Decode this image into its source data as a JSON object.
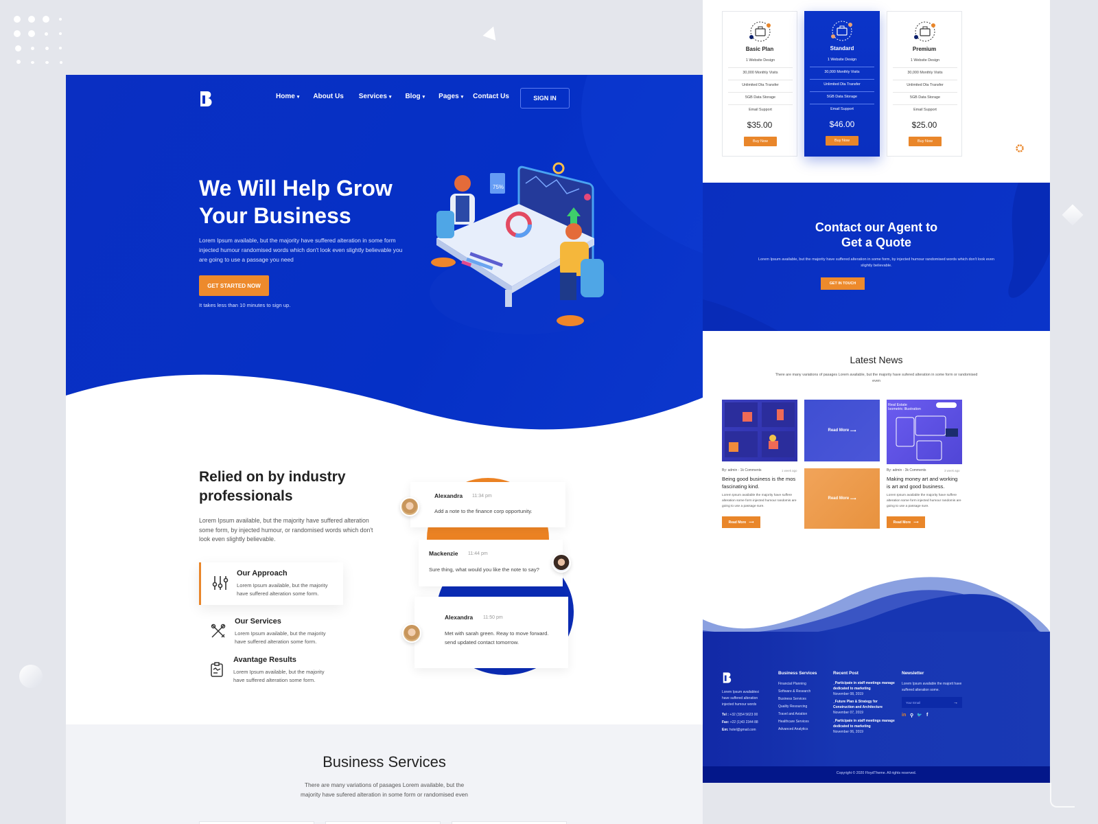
{
  "colors": {
    "primary": "#0a2fc2",
    "accent": "#ed8a2c",
    "dark_text": "#222222",
    "footer_bar": "#03178a"
  },
  "nav": {
    "logo": "b-logo",
    "items": [
      {
        "label": "Home",
        "has_dropdown": true
      },
      {
        "label": "About Us",
        "has_dropdown": false
      },
      {
        "label": "Services",
        "has_dropdown": true
      },
      {
        "label": "Blog",
        "has_dropdown": true
      },
      {
        "label": "Pages",
        "has_dropdown": true
      },
      {
        "label": "Contact Us",
        "has_dropdown": false
      }
    ],
    "caret": "▾",
    "signin_label": "SIGN IN"
  },
  "hero": {
    "title_line1": "We Will Help Grow",
    "title_line2": "Your Business",
    "description": "Lorem Ipsum available, but the majority have suffered alteration in some form injected humour randomised words which don't look even slightly believable you are going to use a passage you need",
    "cta_label": "GET STARTED NOW",
    "note": "It takes less than 10 minutes to sign up.",
    "illustration_badge": "75%"
  },
  "relied": {
    "title": "Relied on by industry professionals",
    "description": "Lorem Ipsum available, but the majority have suffered alteration some form, by injected humour, or randomised words which don't look even slightly believable.",
    "features": [
      {
        "icon": "sliders-icon",
        "title": "Our Approach",
        "desc": "Lorem Ipsum available, but the majority have suffered alteration some form.",
        "active": true
      },
      {
        "icon": "tools-icon",
        "title": "Our Services",
        "desc": "Lorem Ipsum available, but the majority have suffered alteration some form.",
        "active": false
      },
      {
        "icon": "clipboard-icon",
        "title": "Avantage Results",
        "desc": "Lorem Ipsum available, but the majority have suffered alteration some form.",
        "active": false
      }
    ]
  },
  "chat": [
    {
      "name": "Alexandra",
      "time": "11:34 pm",
      "message": "Add a note to the finance corp opportunity."
    },
    {
      "name": "Mackenzie",
      "time": "11:44 pm",
      "message": "Sure thing, what would you like the note to say?"
    },
    {
      "name": "Alexandra",
      "time": "11:50 pm",
      "message": "Met with sarah green. Reay to move forward. send updated contact tomorrow."
    }
  ],
  "business_services": {
    "title": "Business Services",
    "description": "There are many variations of pasages Lorem available, but the majority have sufered alteration in some form or randomised even"
  },
  "pricing": [
    {
      "name": "Basic Plan",
      "features": [
        "1 Website Design",
        "30,000 Monthly Visits",
        "Unlimited Dta Transfer",
        "5GB Data Storage",
        "Email Support"
      ],
      "price": "$35.00",
      "button": "Buy Now",
      "featured": false
    },
    {
      "name": "Standard",
      "features": [
        "1 Website Design",
        "30,000 Monthly Visits",
        "Unlimited Dta Transfer",
        "5GB Data Storage",
        "Email Support"
      ],
      "price": "$46.00",
      "button": "Buy Now",
      "featured": true
    },
    {
      "name": "Premium",
      "features": [
        "1 Website Design",
        "30,000 Monthly Visits",
        "Unlimited Dta Transfer",
        "5GB Data Storage",
        "Email Support"
      ],
      "price": "$25.00",
      "button": "Buy Now",
      "featured": false
    }
  ],
  "contact": {
    "title_line1": "Contact our Agent to",
    "title_line2": "Get a Quote",
    "description": "Lorem Ipsum available, but the majority have suffered alteration in some form, by injected humour randomised words which don't look even slightly believable.",
    "button": "GET IN TOUCH"
  },
  "news": {
    "title": "Latest News",
    "description": "There are many variations of pasages Lorem available, but the majority have sufered alteration in some form or randomised even",
    "posts": [
      {
        "meta": "By: admin - 1k Comments",
        "ago": "1 week ago",
        "title": "Being good business is the mos fascinating kind.",
        "body": "Lorem Ipsum available the majority have suffere alteration some form injected humour randomis are going to use a passage sure.",
        "button": "Read More"
      },
      {
        "meta": "By: admin - 3k Comments",
        "ago": "3 week ago",
        "title": "Making money art and working is art and good business.",
        "body": "Lorem Ipsum available the majority have suffere alteration some form injected humour randomis are going to use a passage sure.",
        "button": "Read More"
      }
    ],
    "overlay_label": "Read More",
    "img3_caption_line1": "Real Estate",
    "img3_caption_line2": "Isometric Illustration"
  },
  "footer": {
    "about": "Lorem Ipsum availablesi have suffered alteration injected humour words",
    "tel_label": "Tel :",
    "tel": "+32 (3)54 5623 00",
    "fax_label": "Fax:",
    "fax": "+22 (1)43 2344 88",
    "email_label": "Em:",
    "email": "hotel@gmail.com",
    "services_title": "Business Services",
    "services": [
      "Financial Planning",
      "Software & Research",
      "Business Services",
      "Quality Resourcing",
      "Travel and Aviation",
      "Healthcare Services",
      "Advanced Analytics"
    ],
    "recent_title": "Recent Post",
    "recent": [
      {
        "title": "_Participate in staff meetings manage dedicated to marketing",
        "date": "November 08, 2019"
      },
      {
        "title": "_Future Plan & Strategy for Construction and Architecture",
        "date": "November 07, 2019"
      },
      {
        "title": "_Participate in staff meetings manage dedicated to marketing",
        "date": "November 06, 2019"
      }
    ],
    "newsletter_title": "Newsletter",
    "newsletter_desc": "Lorem Ipsum available the majorit have suffered alteration some.",
    "email_placeholder": "Your Email",
    "social": [
      "in",
      "⚲",
      "🐦",
      "f"
    ],
    "copyright": "Copyright © 2020 FloydTheme. All rights reserved."
  }
}
